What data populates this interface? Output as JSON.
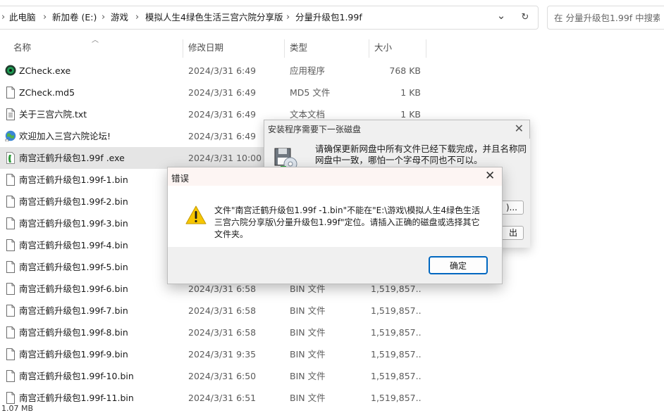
{
  "address": {
    "crumbs": [
      "此电脑",
      "新加卷 (E:)",
      "游戏",
      "模拟人生4绿色生活三宫六院分享版",
      "分量升级包1.99f"
    ],
    "separator": "›",
    "dropdown_glyph": "⌄",
    "refresh_glyph": "↻"
  },
  "search": {
    "placeholder": "在 分量升级包1.99f 中搜索"
  },
  "columns": {
    "name": "名称",
    "date": "修改日期",
    "type": "类型",
    "size": "大小"
  },
  "files": [
    {
      "name": "ZCheck.exe",
      "date": "2024/3/31 6:49",
      "type": "应用程序",
      "size": "768 KB",
      "icon": "app-disc-icon"
    },
    {
      "name": "ZCheck.md5",
      "date": "2024/3/31 6:49",
      "type": "MD5 文件",
      "size": "1 KB",
      "icon": "file-icon"
    },
    {
      "name": "关于三宫六院.txt",
      "date": "2024/3/31 6:49",
      "type": "文本文档",
      "size": "1 KB",
      "icon": "text-file-icon"
    },
    {
      "name": "欢迎加入三宫六院论坛!",
      "date": "2024/3/31 6:49",
      "type": "",
      "size": "",
      "icon": "internet-shortcut-icon"
    },
    {
      "name": "南宫迁鹤升级包1.99f .exe",
      "date": "2024/3/31 10:00",
      "type": "",
      "size": "",
      "icon": "installer-icon"
    },
    {
      "name": "南宫迁鹤升级包1.99f-1.bin",
      "date": "",
      "type": "",
      "size": "",
      "icon": "file-icon"
    },
    {
      "name": "南宫迁鹤升级包1.99f-2.bin",
      "date": "",
      "type": "",
      "size": "",
      "icon": "file-icon"
    },
    {
      "name": "南宫迁鹤升级包1.99f-3.bin",
      "date": "",
      "type": "",
      "size": "",
      "icon": "file-icon"
    },
    {
      "name": "南宫迁鹤升级包1.99f-4.bin",
      "date": "",
      "type": "",
      "size": "",
      "icon": "file-icon"
    },
    {
      "name": "南宫迁鹤升级包1.99f-5.bin",
      "date": "",
      "type": "",
      "size": "",
      "icon": "file-icon"
    },
    {
      "name": "南宫迁鹤升级包1.99f-6.bin",
      "date": "2024/3/31 6:58",
      "type": "BIN 文件",
      "size": "1,519,857...",
      "icon": "file-icon"
    },
    {
      "name": "南宫迁鹤升级包1.99f-7.bin",
      "date": "2024/3/31 6:58",
      "type": "BIN 文件",
      "size": "1,519,857...",
      "icon": "file-icon"
    },
    {
      "name": "南宫迁鹤升级包1.99f-8.bin",
      "date": "2024/3/31 6:58",
      "type": "BIN 文件",
      "size": "1,519,857...",
      "icon": "file-icon"
    },
    {
      "name": "南宫迁鹤升级包1.99f-9.bin",
      "date": "2024/3/31 9:35",
      "type": "BIN 文件",
      "size": "1,519,857...",
      "icon": "file-icon"
    },
    {
      "name": "南宫迁鹤升级包1.99f-10.bin",
      "date": "2024/3/31 6:50",
      "type": "BIN 文件",
      "size": "1,519,857...",
      "icon": "file-icon"
    },
    {
      "name": "南宫迁鹤升级包1.99f-11.bin",
      "date": "2024/3/31 6:51",
      "type": "BIN 文件",
      "size": "1,519,857...",
      "icon": "file-icon"
    }
  ],
  "selected_index": 4,
  "status": {
    "text": "1.07 MB"
  },
  "disk_dialog": {
    "title": "安装程序需要下一张磁盘",
    "message": "请确保更新网盘中所有文件已经下载完成，并且名称同网盘中一致，哪怕一个字母不同也不可以。",
    "browse_label": ")...",
    "exit_label": "出"
  },
  "error_dialog": {
    "title": "错误",
    "message": "文件\"南宫迁鹤升级包1.99f -1.bin\"不能在\"E:\\游戏\\模拟人生4绿色生活三宫六院分享版\\分量升级包1.99f\"定位。请插入正确的磁盘或选择其它文件夹。",
    "ok_label": "确定",
    "icon": "warning-icon"
  },
  "colors": {
    "selection": "#e5e5e5",
    "accent": "#0067c0",
    "warning": "#f7c600"
  }
}
